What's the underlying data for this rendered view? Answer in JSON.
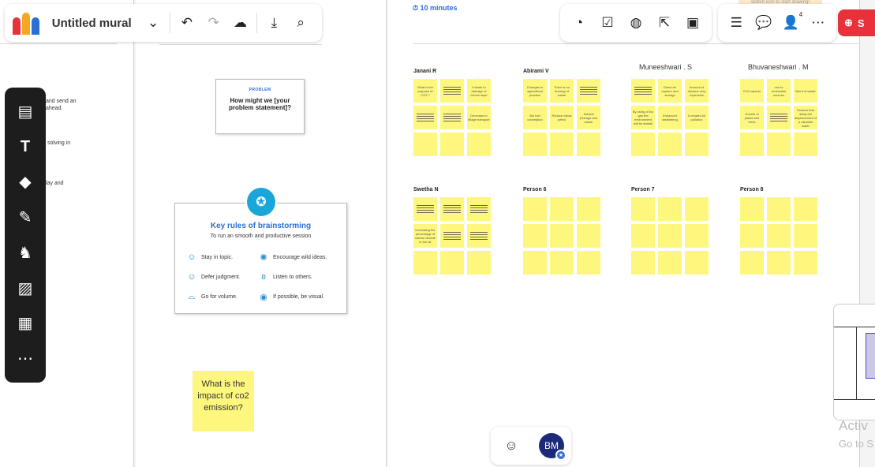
{
  "app": {
    "title": "Untitled mural",
    "logo_colors": [
      "#e8313a",
      "#f5a623",
      "#2a6fd6",
      "#7b3fe4"
    ]
  },
  "toolbar_left": {
    "dropdown_icon": "chevron-down-icon",
    "undo_icon": "undo-icon",
    "redo_icon": "redo-icon",
    "cloud_icon": "cloud-saved-icon",
    "export_icon": "download-icon",
    "search_icon": "search-icon"
  },
  "toolbar_mid": [
    "timer-icon",
    "checkbox-icon",
    "private-mode-icon",
    "select-icon",
    "toolbox-icon"
  ],
  "toolbar_right": {
    "icons": [
      "outline-icon",
      "comment-icon",
      "members-icon",
      "more-icon"
    ],
    "member_count": "4"
  },
  "share_label": "S",
  "timer_label": "10 minutes",
  "top_note": "sketch icon to start drawing!",
  "side_tools": [
    "sticky-note-icon",
    "text-icon",
    "shapes-icon",
    "draw-icon",
    "llama-icon",
    "image-icon",
    "templates-icon",
    "more-icon"
  ],
  "left_col_text": [
    "and send an",
    "ahead.",
    "solving in",
    "lay and"
  ],
  "problem_card": {
    "label": "PROBLEM",
    "question": "How might we [your problem statement]?"
  },
  "rules_card": {
    "title": "Key rules of brainstorming",
    "subtitle": "To run an smooth and productive session",
    "rules": [
      {
        "icon": "smile-icon",
        "text": "Stay in topic."
      },
      {
        "icon": "lightbulb-icon",
        "text": "Encourage wild ideas."
      },
      {
        "icon": "smile-icon",
        "text": "Defer judgment."
      },
      {
        "icon": "ear-icon",
        "text": "Listen to others."
      },
      {
        "icon": "cup-icon",
        "text": "Go for volume."
      },
      {
        "icon": "eye-icon",
        "text": "If possible, be visual."
      }
    ]
  },
  "big_sticky": "What is the impact of co2 emission?",
  "persons": [
    {
      "name": "Janani R",
      "notes": [
        "What is the purpose of CO2 ?",
        "",
        "It leads to damage of Ozone layer",
        "",
        "",
        "Decrease to fillage transport",
        "",
        "",
        ""
      ]
    },
    {
      "name": "Abirami V",
      "notes": [
        "Changes in agricultural practice",
        "There is no burning of waste",
        "",
        "Bio fuel conception",
        "Reduce follow petrol",
        "Subsidi (Garage and waste",
        "",
        "",
        ""
      ]
    },
    {
      "name": "Muneeshwari . S",
      "notes": [
        "",
        "Direct air capture and storage",
        "Amount of dioxane very expensive",
        "By using of bio gas the environment will be shabbi",
        "Enhanced weathering",
        "It creates Air pollution",
        "",
        "",
        ""
      ]
    },
    {
      "name": "Bhuvaneshwari . M",
      "notes": [
        "CO2 capture",
        "use to renewable sources",
        "Burnt of waste",
        "Growth of plants and trees",
        "",
        "Reason that delay the displacement of a valuable water",
        "",
        "",
        ""
      ]
    },
    {
      "name": "Swetha N",
      "notes": [
        "",
        "",
        "",
        "Increasing the percentage of carbon dioxide in the air",
        "",
        "",
        "",
        "",
        ""
      ]
    },
    {
      "name": "Person 6",
      "notes": [
        "",
        "",
        "",
        "",
        "",
        "",
        "",
        "",
        ""
      ]
    },
    {
      "name": "Person 7",
      "notes": [
        "",
        "",
        "",
        "",
        "",
        "",
        "",
        "",
        ""
      ]
    },
    {
      "name": "Person 8",
      "notes": [
        "",
        "",
        "",
        "",
        "",
        "",
        "",
        "",
        ""
      ]
    }
  ],
  "bottom_bar": {
    "emoji_icon": "smiley-icon",
    "avatar_initials": "BM"
  },
  "watermark": {
    "line1": "Activ",
    "line2": "Go to S"
  }
}
